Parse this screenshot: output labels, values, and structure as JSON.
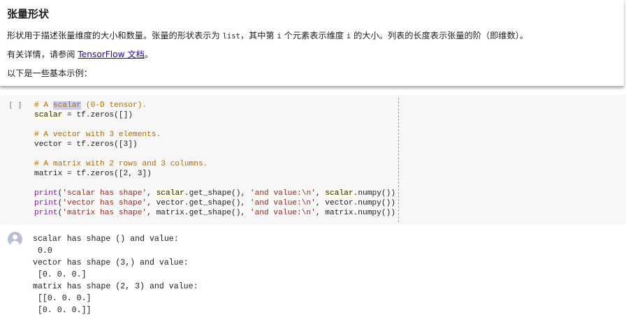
{
  "text_cell": {
    "title": "张量形状",
    "p1_before": "形状用于描述张量维度的大小和数量。张量的形状表示为 ",
    "p1_code1": "list",
    "p1_mid1": "，其中第 ",
    "p1_code2": "i",
    "p1_mid2": " 个元素表示维度 ",
    "p1_code3": "i",
    "p1_after": " 的大小。列表的长度表示张量的阶（即维数）。",
    "p2_before": "有关详情，请参阅 ",
    "p2_link": "TensorFlow 文档",
    "p2_after": "。",
    "p3": "以下是一些基本示例："
  },
  "code_cell": {
    "run_indicator": "[ ]",
    "comment1_prefix": "# A ",
    "comment1_word": "scalar",
    "comment1_suffix": " (0-D tensor).",
    "line2_var": "scalar",
    "line2_rest": " = tf.zeros([])",
    "comment2": "# A vector with 3 elements.",
    "line4": "vector = tf.zeros([3])",
    "comment3": "# A matrix with 2 rows and 3 columns.",
    "line6": "matrix = tf.zeros([2, 3])",
    "print_kw": "print",
    "p1_str": "'scalar has shape'",
    "p1_var1": "scalar",
    "p1_mid": ".get_shape(), ",
    "p1_str2": "'and value:\\n'",
    "p1_sep": ", ",
    "p1_var2": "scalar",
    "p1_end": ".numpy())",
    "p2_str": "'vector has shape'",
    "p2_mid": ", vector.get_shape(), ",
    "p2_str2": "'and value:\\n'",
    "p2_end": ", vector.numpy())",
    "p3_str": "'matrix has shape'",
    "p3_mid": ", matrix.get_shape(), ",
    "p3_str2": "'and value:\\n'",
    "p3_end": ", matrix.numpy())"
  },
  "output": {
    "text": "scalar has shape () and value:\n 0.0\nvector has shape (3,) and value:\n [0. 0. 0.]\nmatrix has shape (2, 3) and value:\n [[0. 0. 0.]\n [0. 0. 0.]]"
  }
}
